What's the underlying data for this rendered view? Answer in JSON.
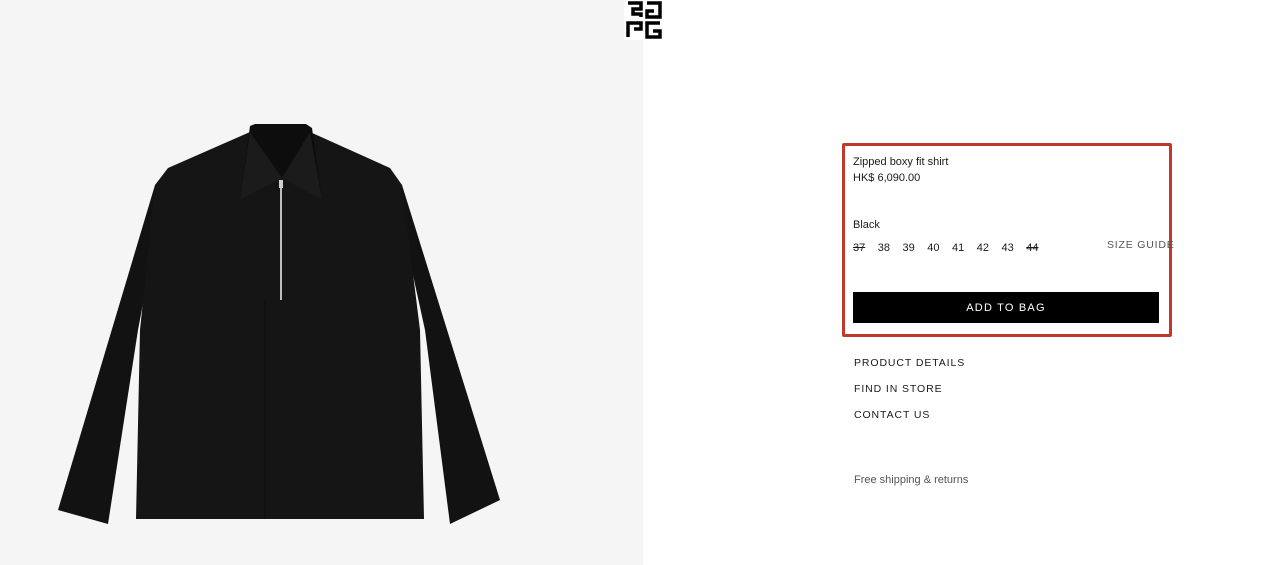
{
  "brand": {
    "logo_icon": "givenchy-4g-logo-icon"
  },
  "product": {
    "image_icon": "black-zipped-shirt-image",
    "name": "Zipped boxy fit shirt",
    "price": "HK$ 6,090.00",
    "color": "Black",
    "sizes": [
      {
        "label": "37",
        "available": false
      },
      {
        "label": "38",
        "available": true
      },
      {
        "label": "39",
        "available": true
      },
      {
        "label": "40",
        "available": true
      },
      {
        "label": "41",
        "available": true
      },
      {
        "label": "42",
        "available": true
      },
      {
        "label": "43",
        "available": true
      },
      {
        "label": "44",
        "available": false
      }
    ],
    "size_guide_label": "SIZE GUIDE",
    "add_to_bag_label": "ADD TO BAG"
  },
  "links": {
    "product_details": "PRODUCT DETAILS",
    "find_in_store": "FIND IN STORE",
    "contact_us": "CONTACT US"
  },
  "footer_note": "Free shipping & returns",
  "colors": {
    "highlight_border": "#c0392b",
    "button_bg": "#000000",
    "gallery_bg": "#f5f5f5"
  }
}
